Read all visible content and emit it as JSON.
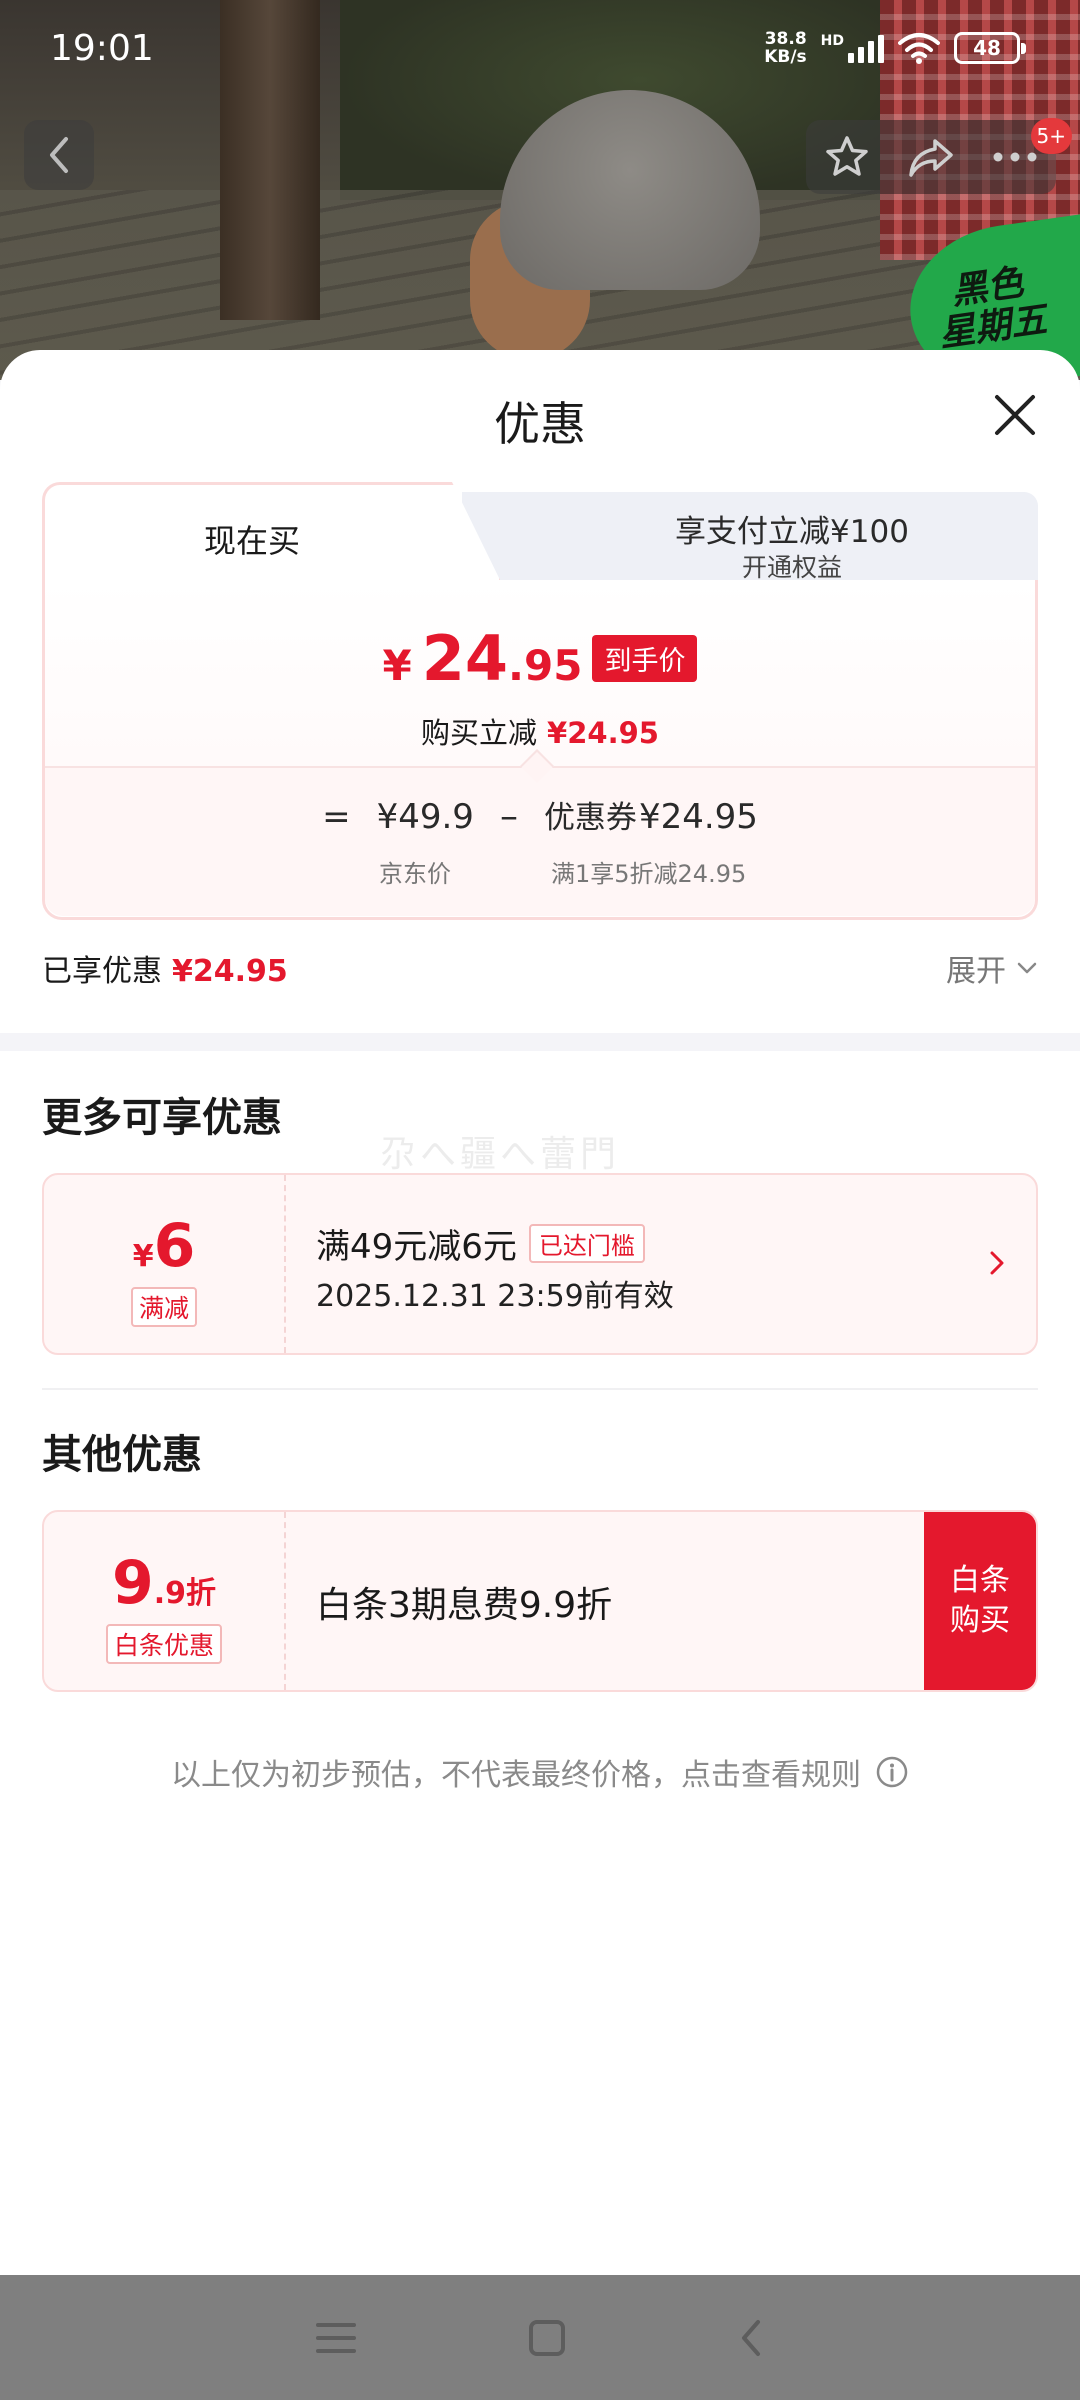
{
  "status_bar": {
    "time": "19:01",
    "net_speed_line1": "38.8",
    "net_speed_line2": "KB/s",
    "hd": "HD",
    "battery": "48"
  },
  "top": {
    "message_badge": "5+",
    "promo_badge_line1": "黑色",
    "promo_badge_line2": "星期五"
  },
  "sheet": {
    "title": "优惠",
    "tabs": {
      "active_label": "现在买",
      "inactive_main": "享支付立减¥100",
      "inactive_sub": "开通权益"
    },
    "final_price": {
      "currency": "¥",
      "integer": "24",
      "decimal": ".95",
      "tag": "到手价"
    },
    "instant": {
      "label": "购买立减",
      "amount": "¥24.95"
    },
    "formula": {
      "equals": "=",
      "jd_price": "¥49.9",
      "minus": "–",
      "coupon_label": "优惠券",
      "coupon_amount": "¥24.95",
      "jd_price_caption": "京东价",
      "coupon_caption": "满1享5折减24.95"
    },
    "enjoyed": {
      "label": "已享优惠",
      "amount": "¥24.95"
    },
    "expand": {
      "label": "展开"
    },
    "watermark": "尕へ疆へ蕾門",
    "more_section": {
      "title": "更多可享优惠",
      "coupon": {
        "currency": "¥",
        "value": "6",
        "tag": "满减",
        "title": "满49元减6元",
        "status": "已达门槛",
        "validity": "2025.12.31 23:59前有效"
      }
    },
    "other_section": {
      "title": "其他优惠",
      "baitiao": {
        "value_big": "9",
        "value_small": ".9",
        "unit": "折",
        "tag": "白条优惠",
        "title": "白条3期息费9.9折",
        "button": "白条购买"
      }
    },
    "footnote": "以上仅为初步预估，不代表最终价格，点击查看规则"
  },
  "colors": {
    "accent": "#e4182d",
    "promo_green": "#22a84a"
  }
}
